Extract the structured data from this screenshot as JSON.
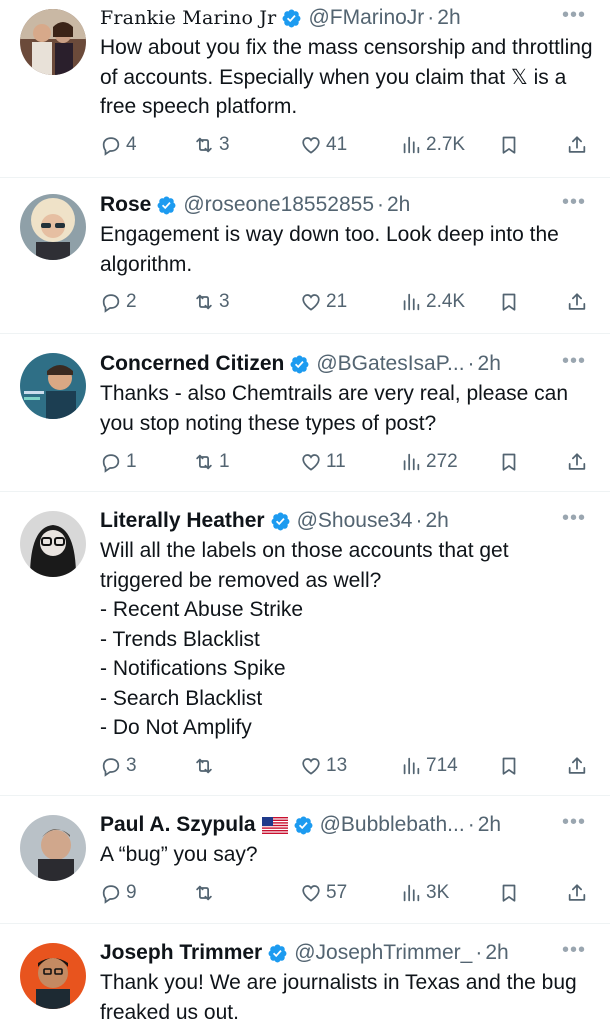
{
  "tweets": [
    {
      "name": "Frankie Marino Jr",
      "handle": "@FMarinoJr",
      "time": "2h",
      "text": "How about you fix the mass censorship and throttling of accounts. Especially when you claim that 𝕏 is a free speech platform.",
      "replies": "4",
      "reposts": "3",
      "likes": "41",
      "views": "2.7K"
    },
    {
      "name": "Rose",
      "handle": "@roseone18552855",
      "time": "2h",
      "text": "Engagement is way down too. Look deep into the algorithm.",
      "replies": "2",
      "reposts": "3",
      "likes": "21",
      "views": "2.4K"
    },
    {
      "name": "Concerned Citizen",
      "handle": "@BGatesIsaP...",
      "time": "2h",
      "text": "Thanks - also Chemtrails are very real, please can you stop noting these types of post?",
      "replies": "1",
      "reposts": "1",
      "likes": "11",
      "views": "272"
    },
    {
      "name": "Literally Heather",
      "handle": "@Shouse34",
      "time": "2h",
      "text": "Will all the labels on those accounts that get triggered be removed as well?\n- Recent Abuse Strike\n- Trends Blacklist\n- Notifications Spike\n- Search Blacklist\n- Do Not Amplify",
      "replies": "3",
      "reposts": "",
      "likes": "13",
      "views": "714"
    },
    {
      "name": "Paul A. Szypula",
      "handle": "@Bubblebath...",
      "time": "2h",
      "text": "A “bug” you say?",
      "replies": "9",
      "reposts": "",
      "likes": "57",
      "views": "3K"
    },
    {
      "name": "Joseph Trimmer",
      "handle": "@JosephTrimmer_",
      "time": "2h",
      "text": "Thank you! We are journalists in Texas and the bug freaked us out.",
      "replies": "",
      "reposts": "",
      "likes": "",
      "views": ""
    }
  ],
  "separator_dot": "·",
  "more_glyph": "•••",
  "colors": {
    "verified": "#1d9bf0",
    "secondary_text": "#536471",
    "divider": "#eff3f4"
  }
}
